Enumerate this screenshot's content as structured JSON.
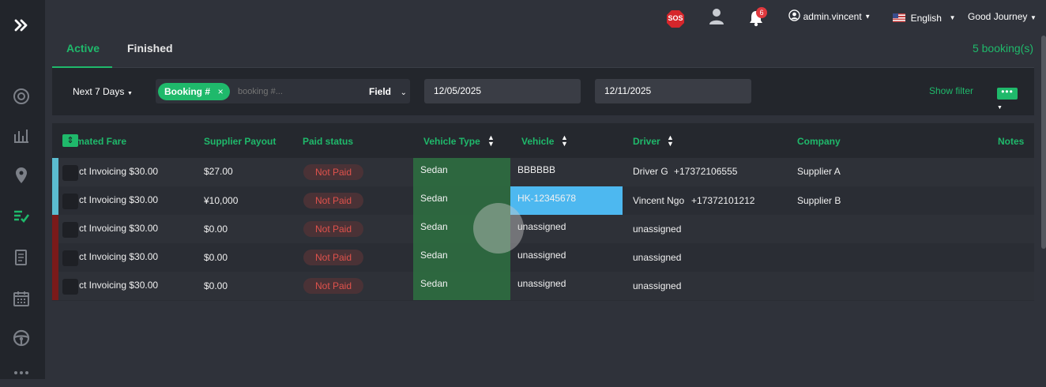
{
  "topbar": {
    "sos_label": "SOS",
    "notification_count": "6",
    "user": "admin.vincent",
    "language": "English",
    "company": "Good Journey"
  },
  "tabs": [
    {
      "label": "Active"
    },
    {
      "label": "Finished"
    }
  ],
  "booking_count": "5 booking(s)",
  "filters": {
    "range": "Next 7 Days",
    "chip": "Booking #",
    "search_placeholder": "booking #...",
    "field": "Field",
    "date_from": "12/05/2025",
    "date_to": "12/11/2025",
    "show_filter": "Show filter"
  },
  "columns": {
    "fare": "mated Fare",
    "supplier_payout": "Supplier Payout",
    "paid_status": "Paid status",
    "vehicle_type": "Vehicle Type",
    "vehicle": "Vehicle",
    "driver": "Driver",
    "company": "Company",
    "notes": "Notes"
  },
  "rows": [
    {
      "fare": "ct Invoicing  $30.00",
      "payout": "$27.00",
      "paid": "Not Paid",
      "vtype": "Sedan",
      "vehicle": "BBBBBB",
      "driver": "Driver G",
      "phone": "+17372106555",
      "company": "Supplier A"
    },
    {
      "fare": "ct Invoicing  $30.00",
      "payout": "¥10,000",
      "paid": "Not Paid",
      "vtype": "Sedan",
      "vehicle": "HK-12345678",
      "driver": "Vincent Ngo",
      "phone": "+17372101212",
      "company": "Supplier B"
    },
    {
      "fare": "ct Invoicing  $30.00",
      "payout": "$0.00",
      "paid": "Not Paid",
      "vtype": "Sedan",
      "vehicle": "unassigned",
      "driver": "unassigned",
      "phone": "",
      "company": ""
    },
    {
      "fare": "ct Invoicing  $30.00",
      "payout": "$0.00",
      "paid": "Not Paid",
      "vtype": "Sedan",
      "vehicle": "unassigned",
      "driver": "unassigned",
      "phone": "",
      "company": ""
    },
    {
      "fare": "ct Invoicing  $30.00",
      "payout": "$0.00",
      "paid": "Not Paid",
      "vtype": "Sedan",
      "vehicle": "unassigned",
      "driver": "unassigned",
      "phone": "",
      "company": ""
    }
  ],
  "colors": {
    "accent": "#1fb96b",
    "row_active": "#5bbcd0",
    "row_alert": "#7a1a1a",
    "vehicle_highlight": "#4db8f0",
    "vehicle_type_bg": "#2e6b40"
  }
}
